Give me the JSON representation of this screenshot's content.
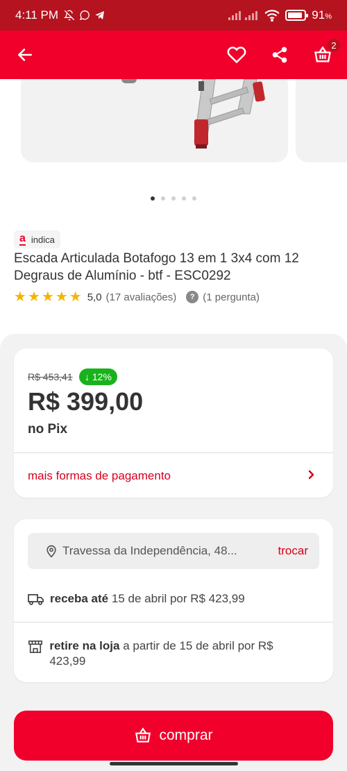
{
  "status_bar": {
    "time": "4:11 PM",
    "battery": "91",
    "battery_unit": "%",
    "battery_level": 0.91
  },
  "app_bar": {
    "cart_count": "2"
  },
  "gallery": {
    "dots": 5,
    "active_index": 0
  },
  "badge": {
    "logo": "a",
    "label": "indica"
  },
  "product": {
    "title": "Escada Articulada Botafogo 13 em 1 3x4 com 12 Degraus de Alumínio - btf - ESC0292",
    "rating": "5,0",
    "reviews": "(17 avaliações)",
    "questions": "(1 pergunta)",
    "stars": 5
  },
  "price": {
    "old": "R$ 453,41",
    "discount": "↓ 12%",
    "current": "R$ 399,00",
    "method": "no Pix",
    "more_payment": "mais formas de pagamento"
  },
  "shipping": {
    "address": "Travessa da Independência, 48...",
    "change": "trocar",
    "delivery_bold": "receba até",
    "delivery_text": "15 de abril por R$ 423,99",
    "pickup_bold": "retire na loja",
    "pickup_text": "a partir de 15 de abril por R$ 423,99"
  },
  "cta": {
    "label": "comprar"
  },
  "colors": {
    "primary": "#f0002a",
    "status": "#b5131f",
    "link": "#d6001c",
    "discount": "#19b21c",
    "star": "#f4b400"
  }
}
